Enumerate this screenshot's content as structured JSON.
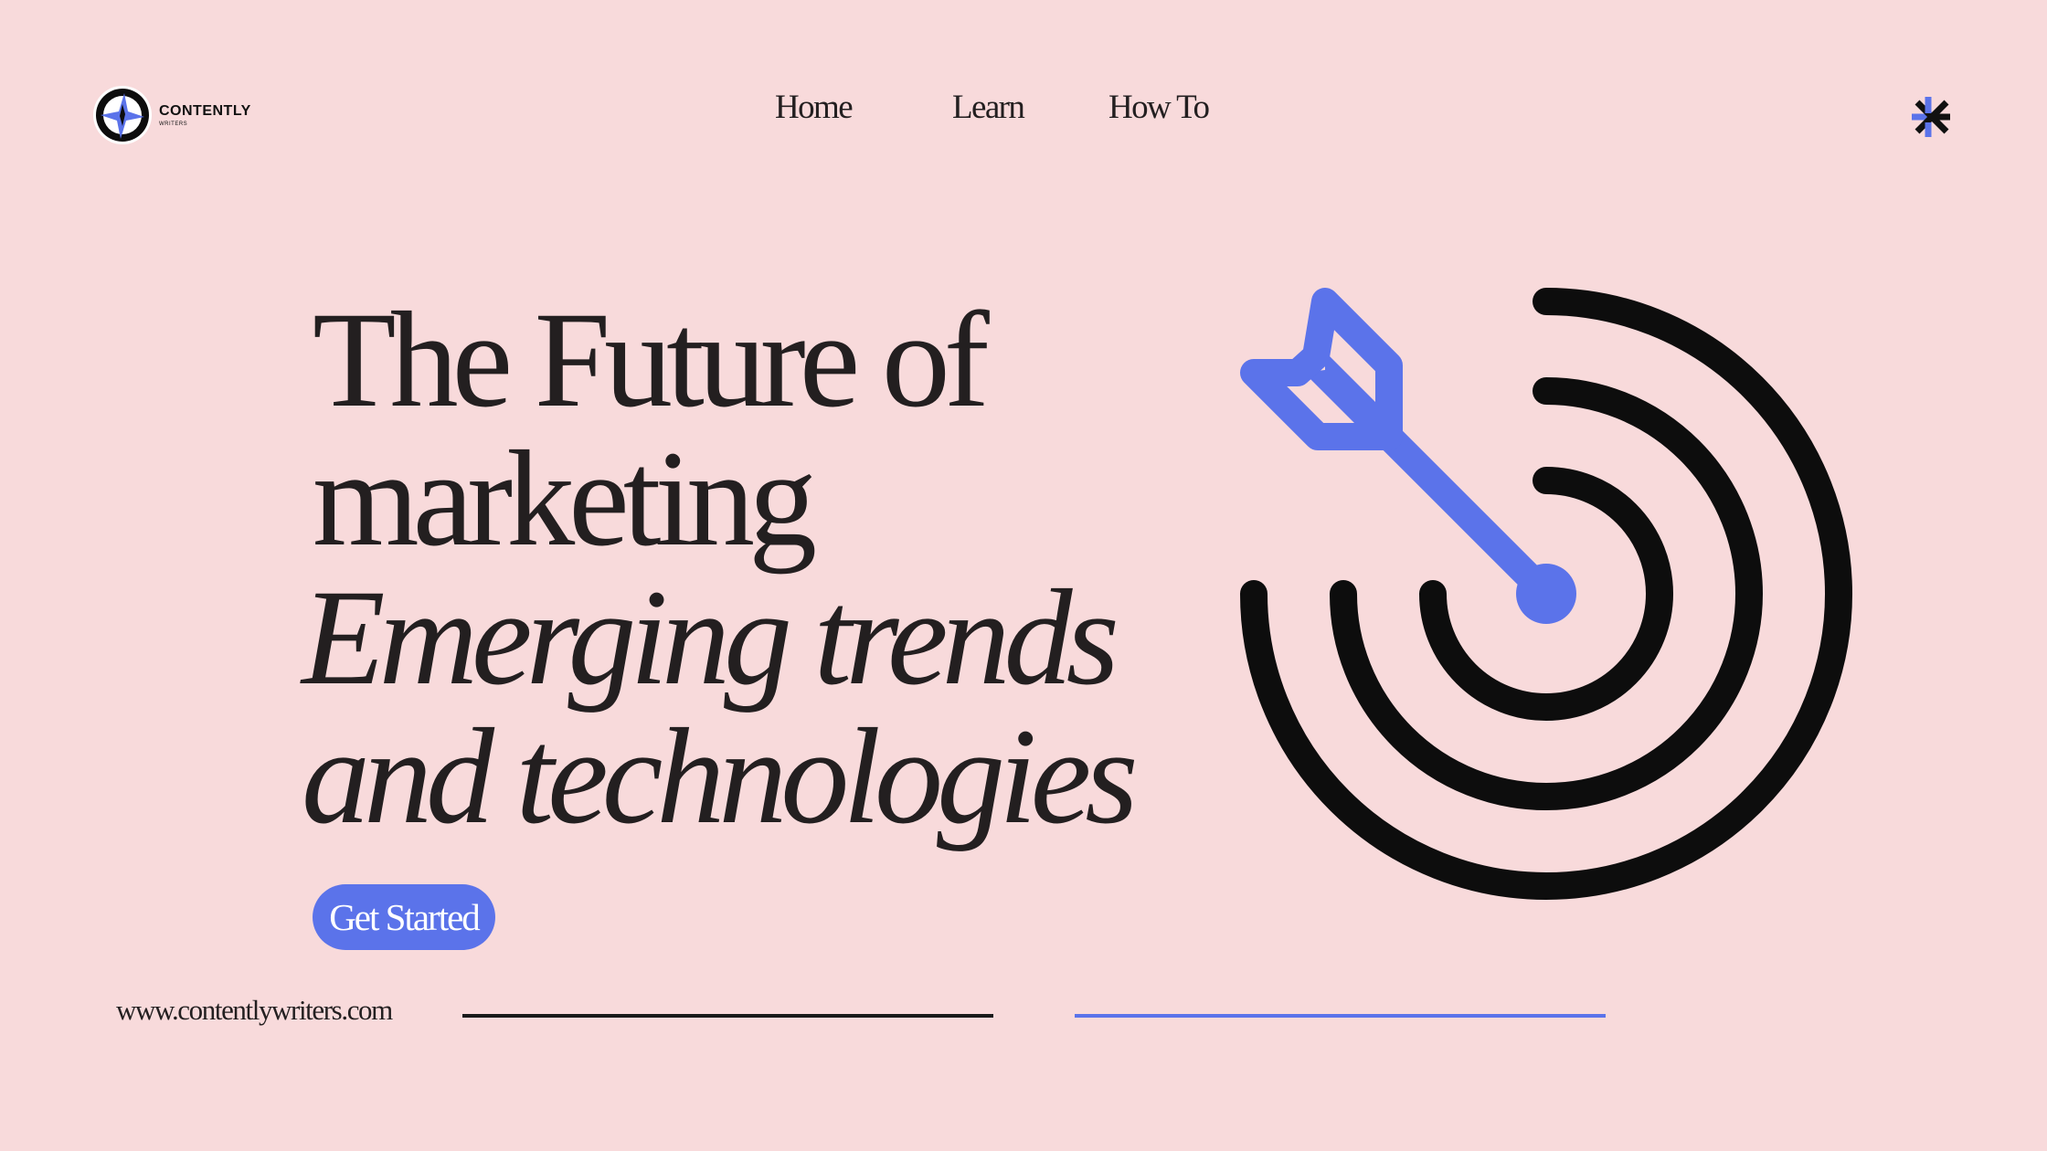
{
  "brand": {
    "name": "CONTENTLY",
    "sub": "WRITERS",
    "logo_icon": "compass-star-icon"
  },
  "nav": {
    "items": [
      {
        "label": "Home"
      },
      {
        "label": "Learn"
      },
      {
        "label": "How To"
      }
    ],
    "menu_icon": "asterisk-icon"
  },
  "hero": {
    "line1": "The Future of",
    "line2": "marketing",
    "line3": "Emerging trends",
    "line4": "and technologies",
    "cta_label": "Get Started",
    "illustration": "target-arrow-icon"
  },
  "footer": {
    "url": "www.contentlywriters.com"
  },
  "colors": {
    "background": "#f8dadb",
    "accent": "#5b73ea",
    "text": "#231f20"
  }
}
